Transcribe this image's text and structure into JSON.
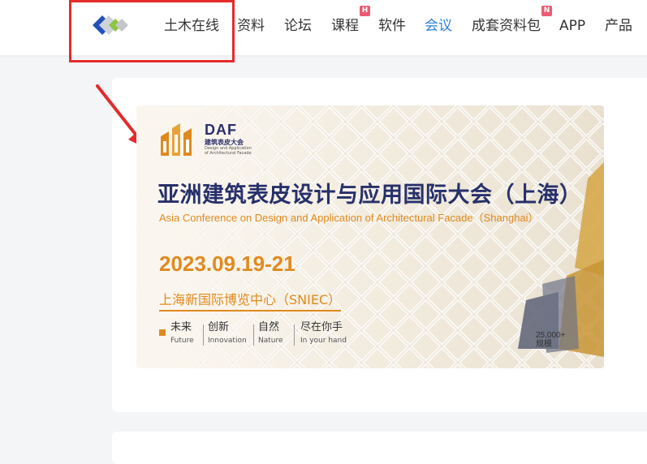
{
  "nav": {
    "brand": "土木在线",
    "items": [
      {
        "label": "资料",
        "active": false,
        "badge": ""
      },
      {
        "label": "论坛",
        "active": false,
        "badge": ""
      },
      {
        "label": "课程",
        "active": false,
        "badge": "H"
      },
      {
        "label": "软件",
        "active": false,
        "badge": ""
      },
      {
        "label": "会议",
        "active": true,
        "badge": ""
      },
      {
        "label": "成套资料包",
        "active": false,
        "badge": "N"
      },
      {
        "label": "APP",
        "active": false,
        "badge": ""
      },
      {
        "label": "产品",
        "active": false,
        "badge": ""
      }
    ]
  },
  "banner": {
    "logo_text": "DAF",
    "logo_cn": "建筑表皮大会",
    "logo_en": "Design and Application of Architectural Facade",
    "title_cn": "亚洲建筑表皮设计与应用国际大会（上海）",
    "title_en": "Asia Conference on Design and Application of Architectural Facade（Shanghai）",
    "date": "2023.09.19-21",
    "venue": "上海新国际博览中心（SNIEC）",
    "slogans": [
      {
        "cn": "未来",
        "en": "Future"
      },
      {
        "cn": "创新",
        "en": "Innovation"
      },
      {
        "cn": "自然",
        "en": "Nature"
      },
      {
        "cn": "尽在你手",
        "en": "In your hand"
      }
    ],
    "scale_num": "25,000+",
    "scale_label": "规模"
  },
  "colors": {
    "accent": "#2a7fd8",
    "annotation": "#e32b2b",
    "banner_orange": "#e08a1e",
    "banner_navy": "#27306a"
  }
}
